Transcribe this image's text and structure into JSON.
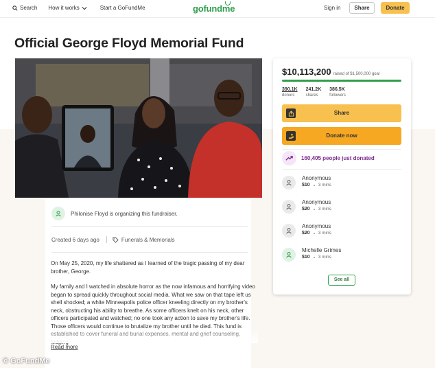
{
  "nav": {
    "search": "Search",
    "how_it_works": "How it works",
    "start": "Start a GoFundMe",
    "logo": "gofundme",
    "signin": "Sign in",
    "share": "Share",
    "donate": "Donate"
  },
  "campaign": {
    "title": "Official George Floyd Memorial Fund",
    "organizer": "Philonise Floyd is organizing this fundraiser.",
    "created": "Created 6 days ago",
    "category": "Funerals & Memorials",
    "story": [
      "On May 25, 2020, my life shattered as I learned of the tragic passing of my dear brother, George.",
      "My family and I watched in absolute horror as the now infamous and horrifying video began to spread quickly throughout social media. What we saw on that tape left us shell shocked; a white Minneapolis police officer kneeling directly on my brother's neck, obstructing his ability to breathe. As some officers knelt on his neck, other officers participated and watched; no one took any action to save my brother's life.  Those officers would continue to brutalize my brother until he died. This fund is established to cover funeral and burial expenses, mental and grief counseling, lodging"
    ],
    "read_more": "Read more"
  },
  "panel": {
    "raised": "$10,113,200",
    "goal": "raised of $1,500,000 goal",
    "progress_fraction": 1.0,
    "stats": [
      {
        "value": "390.1K",
        "label": "donors"
      },
      {
        "value": "241.2K",
        "label": "shares"
      },
      {
        "value": "386.5K",
        "label": "followers"
      }
    ],
    "share_button": "Share",
    "donate_button": "Donate now",
    "trending": "160,405 people just donated",
    "donations": [
      {
        "name": "Anonymous",
        "amount": "$10",
        "time": "3 mins"
      },
      {
        "name": "Anonymous",
        "amount": "$20",
        "time": "3 mins"
      },
      {
        "name": "Anonymous",
        "amount": "$20",
        "time": "3 mins"
      },
      {
        "name": "Michelle Grimes",
        "amount": "$10",
        "time": "3 mins"
      }
    ],
    "see_all": "See all"
  },
  "watermark": "© GoFundMe",
  "colors": {
    "brand_green": "#2f9f4a",
    "donate_yellow": "#f8c04e",
    "donate_orange": "#f7a823",
    "trend_purple": "#7a2a8a"
  }
}
